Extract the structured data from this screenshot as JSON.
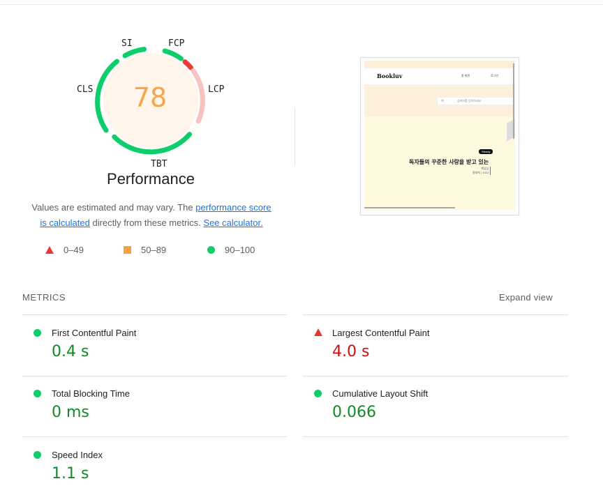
{
  "gauge": {
    "score": "78",
    "title": "Performance",
    "metric_labels": {
      "si": "SI",
      "fcp": "FCP",
      "lcp": "LCP",
      "cls": "CLS",
      "tbt": "TBT"
    },
    "colors": {
      "good": "#0cce6b",
      "bad": "#eb3b3b",
      "bad_light": "#f8c2c2",
      "average": "#f4a64f",
      "fill": "#fff5ea"
    }
  },
  "description": {
    "prefix": "Values are estimated and may vary. The ",
    "link1_line1": "performance score",
    "link1_line2": "is calculated",
    "middle": " directly from these metrics. ",
    "link2": "See calculator."
  },
  "legend": {
    "fail": "0–49",
    "average": "50–89",
    "pass": "90–100"
  },
  "screenshot": {
    "logo": "Bookluv",
    "nav_links": [
      "홈 화면",
      "로그인"
    ],
    "search_placeholder": "검색어를 입력하세요",
    "search_select": "책",
    "badge": "Steady",
    "headline": "독자들의 꾸준한 사랑을 받고 있는",
    "sub_line1": "책심심",
    "sub_line2": "칼대지 | 1013"
  },
  "metrics": {
    "section_title": "METRICS",
    "expand_label": "Expand view",
    "items": [
      {
        "name": "First Contentful Paint",
        "value": "0.4 s",
        "status": "pass"
      },
      {
        "name": "Largest Contentful Paint",
        "value": "4.0 s",
        "status": "fail"
      },
      {
        "name": "Total Blocking Time",
        "value": "0 ms",
        "status": "pass"
      },
      {
        "name": "Cumulative Layout Shift",
        "value": "0.066",
        "status": "pass"
      },
      {
        "name": "Speed Index",
        "value": "1.1 s",
        "status": "pass"
      }
    ]
  }
}
